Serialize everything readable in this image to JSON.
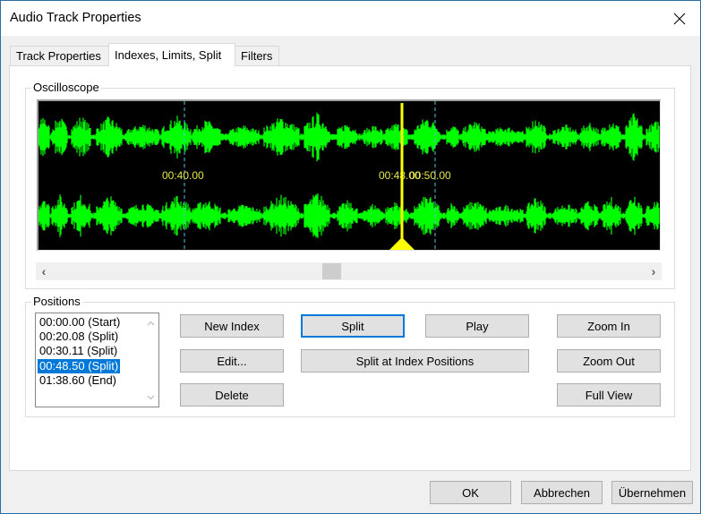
{
  "window": {
    "title": "Audio Track Properties",
    "close_icon": "close-icon"
  },
  "tabs": [
    {
      "label": "Track Properties",
      "active": false
    },
    {
      "label": "Indexes, Limits, Split",
      "active": true
    },
    {
      "label": "Filters",
      "active": false
    }
  ],
  "oscilloscope": {
    "label": "Oscilloscope",
    "time_labels": [
      "00:40.00",
      "00:48.00",
      "00:50.00"
    ],
    "cursor_position": "00:48.50",
    "colors": {
      "background": "#000000",
      "waveform": "#00ff00",
      "cursor": "#ffff00",
      "marker_lines": "#4fc3d9",
      "time_label": "#e6e64d"
    },
    "scrollbar": {
      "left_arrow": "‹",
      "right_arrow": "›",
      "thumb_position_fraction": 0.47
    }
  },
  "positions": {
    "label": "Positions",
    "items": [
      {
        "text": "00:00.00 (Start)",
        "selected": false
      },
      {
        "text": "00:20.08 (Split)",
        "selected": false
      },
      {
        "text": "00:30.11 (Split)",
        "selected": false
      },
      {
        "text": "00:48.50 (Split)",
        "selected": true
      },
      {
        "text": "01:38.60 (End)",
        "selected": false
      }
    ]
  },
  "buttons": {
    "new_index": "New Index",
    "edit": "Edit...",
    "delete": "Delete",
    "split": "Split",
    "split_at_index": "Split at Index Positions",
    "play": "Play",
    "zoom_in": "Zoom In",
    "zoom_out": "Zoom Out",
    "full_view": "Full View"
  },
  "footer": {
    "ok": "OK",
    "cancel": "Abbrechen",
    "apply": "Übernehmen"
  }
}
